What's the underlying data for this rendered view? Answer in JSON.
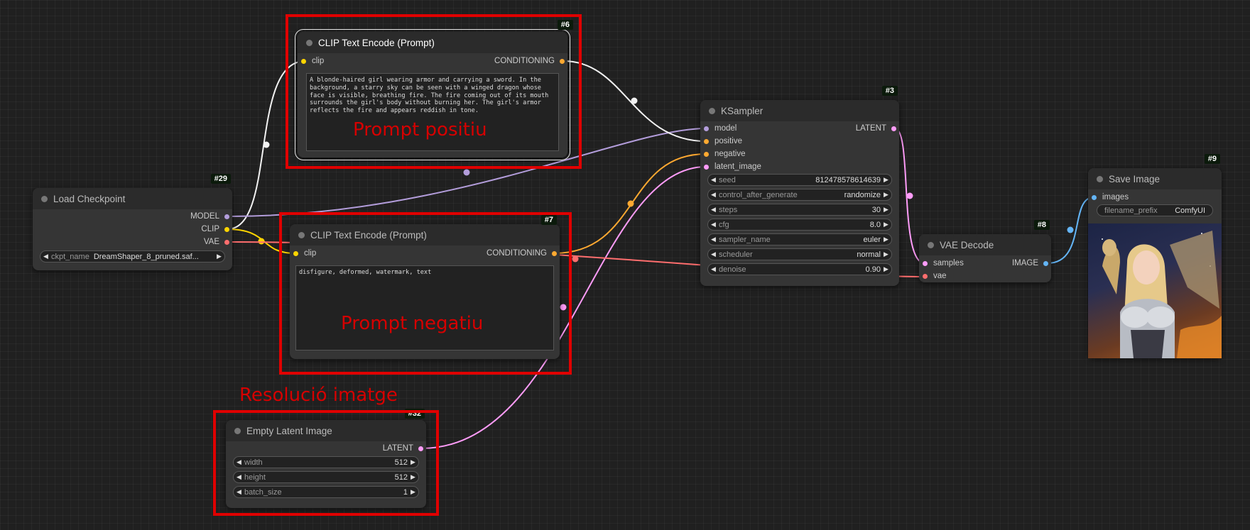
{
  "nodes": {
    "clip_pos": {
      "id": "#6",
      "title": "CLIP Text Encode (Prompt)",
      "input": "clip",
      "output": "CONDITIONING",
      "text": "A blonde-haired girl wearing armor and carrying a sword. In the background, a starry sky can be seen with a winged dragon whose face is visible, breathing fire. The fire coming out of its mouth surrounds the girl's body without burning her. The girl's armor reflects the fire and appears reddish in tone."
    },
    "clip_neg": {
      "id": "#7",
      "title": "CLIP Text Encode (Prompt)",
      "input": "clip",
      "output": "CONDITIONING",
      "text": "disfigure, deformed, watermark, text"
    },
    "checkpoint": {
      "id": "#29",
      "title": "Load Checkpoint",
      "outputs": [
        "MODEL",
        "CLIP",
        "VAE"
      ],
      "ckpt_label": "ckpt_name",
      "ckpt_value": "DreamShaper_8_pruned.saf..."
    },
    "ksampler": {
      "id": "#3",
      "title": "KSampler",
      "inputs": [
        "model",
        "positive",
        "negative",
        "latent_image"
      ],
      "output": "LATENT",
      "widgets": [
        {
          "label": "seed",
          "value": "812478578614639"
        },
        {
          "label": "control_after_generate",
          "value": "randomize"
        },
        {
          "label": "steps",
          "value": "30"
        },
        {
          "label": "cfg",
          "value": "8.0"
        },
        {
          "label": "sampler_name",
          "value": "euler"
        },
        {
          "label": "scheduler",
          "value": "normal"
        },
        {
          "label": "denoise",
          "value": "0.90"
        }
      ]
    },
    "vae_decode": {
      "id": "#8",
      "title": "VAE Decode",
      "inputs": [
        "samples",
        "vae"
      ],
      "output": "IMAGE"
    },
    "save_image": {
      "id": "#9",
      "title": "Save Image",
      "input": "images",
      "widget": {
        "label": "filename_prefix",
        "value": "ComfyUI"
      }
    },
    "empty_latent": {
      "id": "#32",
      "title": "Empty Latent Image",
      "output": "LATENT",
      "widgets": [
        {
          "label": "width",
          "value": "512"
        },
        {
          "label": "height",
          "value": "512"
        },
        {
          "label": "batch_size",
          "value": "1"
        }
      ]
    }
  },
  "annotations": {
    "positive": "Prompt positiu",
    "negative": "Prompt negatiu",
    "resolution": "Resolució imatge"
  },
  "colors": {
    "model": "#b39ddb",
    "clip": "#ffd500",
    "vae": "#ff6e6e",
    "conditioning": "#ffa931",
    "latent": "#ff9cf9",
    "image": "#64b5f6",
    "annotation": "#e00000"
  }
}
